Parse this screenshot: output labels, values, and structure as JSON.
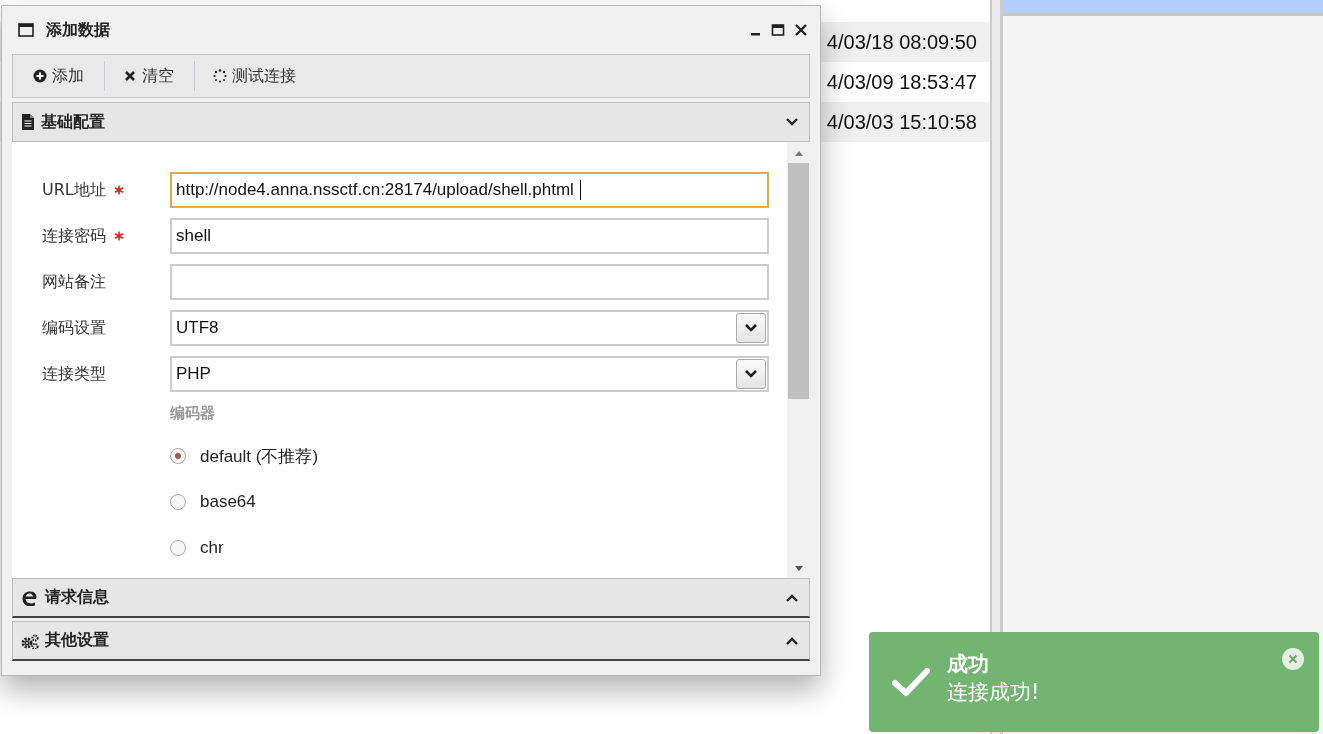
{
  "background_table": {
    "rows": [
      {
        "column_1": "4/03/18 08:09:50"
      },
      {
        "column_1": "4/03/09 18:53:47"
      },
      {
        "column_1": "4/03/03 15:10:58"
      }
    ]
  },
  "window": {
    "title": "添加数据"
  },
  "toolbar": [
    {
      "label": "添加",
      "kind": "add"
    },
    {
      "label": "清空",
      "kind": "clear"
    },
    {
      "label": "测试连接",
      "kind": "test"
    }
  ],
  "sections": [
    {
      "title": "基础配置",
      "kind": "doc",
      "expanded": true
    },
    {
      "title": "请求信息",
      "kind": "edge",
      "expanded": false
    },
    {
      "title": "其他设置",
      "kind": "gears",
      "expanded": false
    }
  ],
  "form": {
    "fields": [
      {
        "label": "URL地址",
        "required": true,
        "kind": "text",
        "value": "http://node4.anna.nssctf.cn:28174/upload/shell.phtml",
        "focused": true
      },
      {
        "label": "连接密码",
        "required": true,
        "kind": "text",
        "value": "shell",
        "focused": false
      },
      {
        "label": "网站备注",
        "required": false,
        "kind": "text",
        "focused": false
      },
      {
        "label": "编码设置",
        "required": false,
        "kind": "select",
        "value": "UTF8",
        "focused": false
      },
      {
        "label": "连接类型",
        "required": false,
        "kind": "select",
        "value": "PHP",
        "focused": false
      }
    ],
    "encoder": {
      "label": "编码器",
      "options": [
        {
          "label": "default (不推荐)",
          "selected": true
        },
        {
          "label": "base64",
          "selected": false
        },
        {
          "label": "chr",
          "selected": false
        }
      ]
    }
  },
  "toast": {
    "title": "成功",
    "message": "连接成功!"
  }
}
